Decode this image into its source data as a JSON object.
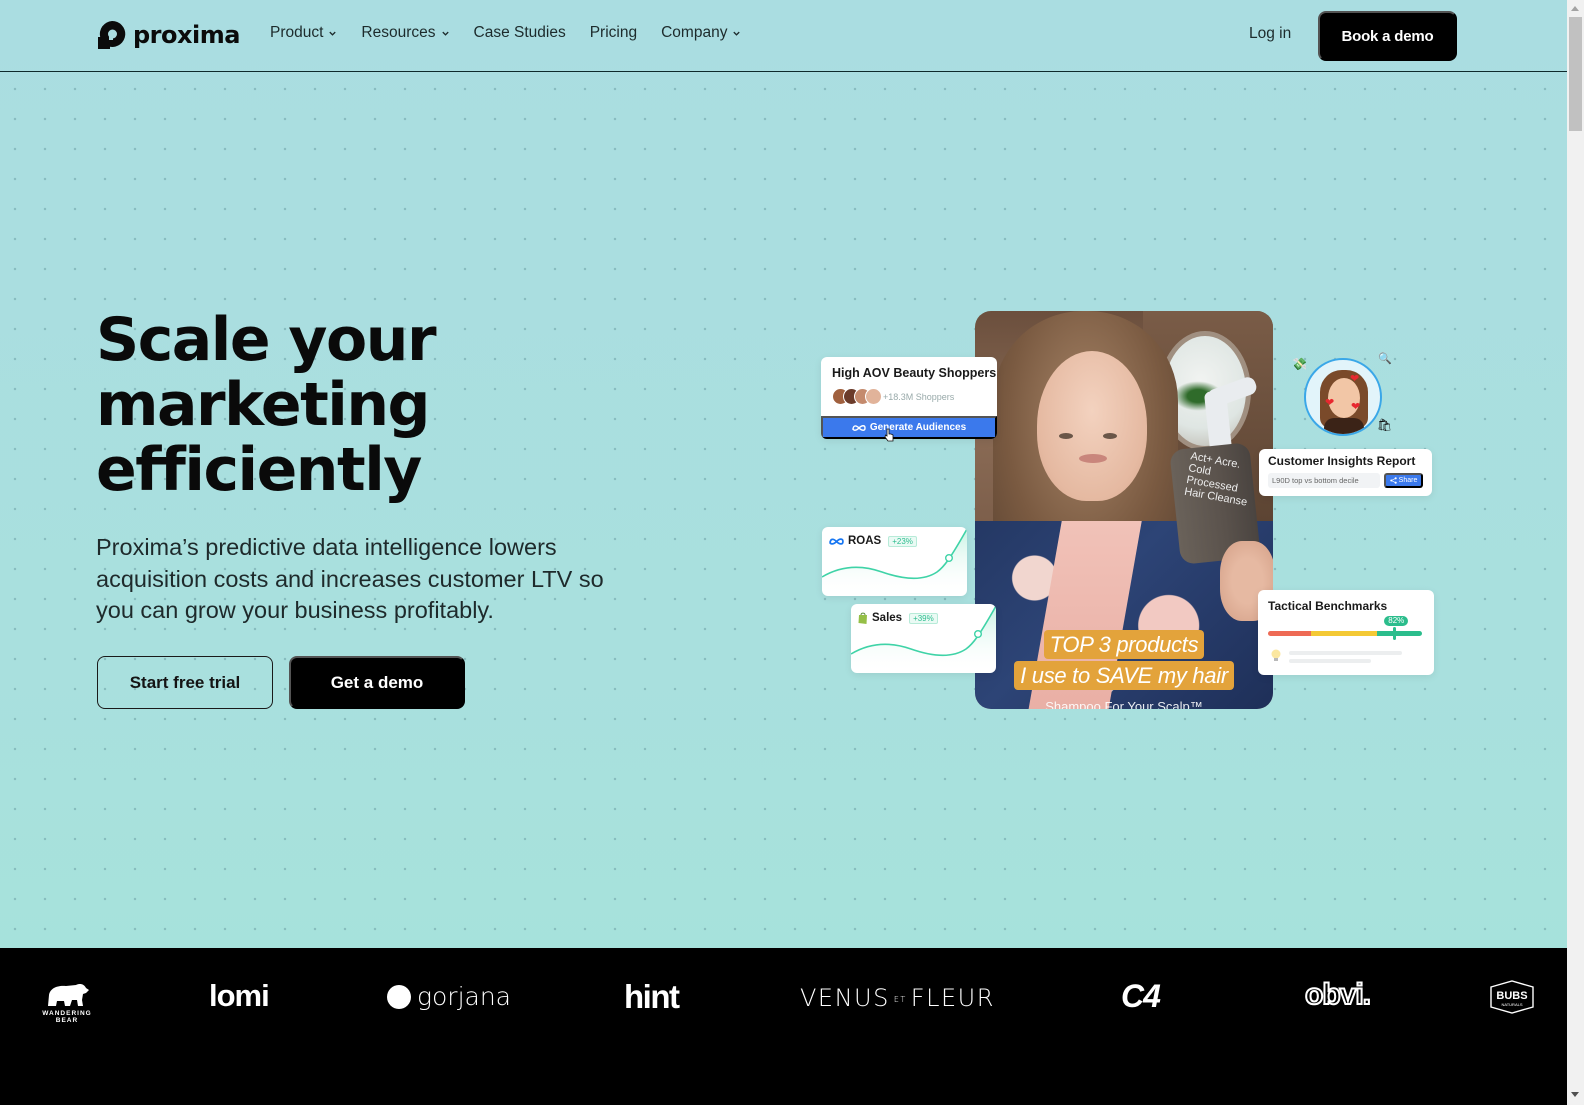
{
  "nav": {
    "brand": "proxima",
    "links": [
      {
        "label": "Product",
        "has_dropdown": true
      },
      {
        "label": "Resources",
        "has_dropdown": true
      },
      {
        "label": "Case Studies",
        "has_dropdown": false
      },
      {
        "label": "Pricing",
        "has_dropdown": false
      },
      {
        "label": "Company",
        "has_dropdown": true
      }
    ],
    "login_label": "Log in",
    "cta_label": "Book a demo"
  },
  "hero": {
    "title_lines": [
      "Scale your",
      "marketing",
      "efficiently"
    ],
    "subtitle": "Proxima’s predictive data intelligence lowers acquisition costs and increases customer LTV so you can grow your business profitably.",
    "primary_button": "Start free trial",
    "secondary_button": "Get a demo"
  },
  "visual": {
    "audience_card": {
      "title": "High AOV Beauty Shoppers",
      "count": "+18.3M Shoppers",
      "button": "Generate Audiences",
      "button_color": "#3b79ec"
    },
    "roas_card": {
      "label": "ROAS",
      "change": "+23%",
      "icon": "meta-icon"
    },
    "sales_card": {
      "label": "Sales",
      "change": "+39%",
      "icon": "shopify-icon"
    },
    "insights_card": {
      "title": "Customer Insights Report",
      "field_value": "L90D top vs bottom decile",
      "share_label": "Share"
    },
    "benchmarks_card": {
      "title": "Tactical Benchmarks",
      "percent_label": "82%",
      "percent_value": 82,
      "colors": {
        "low": "#ee6a55",
        "mid": "#f4c935",
        "high": "#2bbd8c"
      }
    },
    "video": {
      "bottle_text": "Act+ Acre. Cold Processed Hair Cleanse",
      "caption_lines": [
        "TOP 3 products",
        "I use to SAVE my hair"
      ],
      "subcaption": "Shampoo For Your Scalp™",
      "caption_color": "#e3a33b"
    }
  },
  "logos": [
    "WANDERING BEAR",
    "lomi",
    "gorjana",
    "hint",
    "VENUS ET FLEUR",
    "C4",
    "obvi.",
    "BUBS NATURALS"
  ],
  "logo_parts": {
    "venus_a": "VENUS",
    "venus_et": "ET",
    "venus_b": "FLEUR",
    "bubs_a": "BUBS",
    "bubs_b": "NATURALS"
  }
}
